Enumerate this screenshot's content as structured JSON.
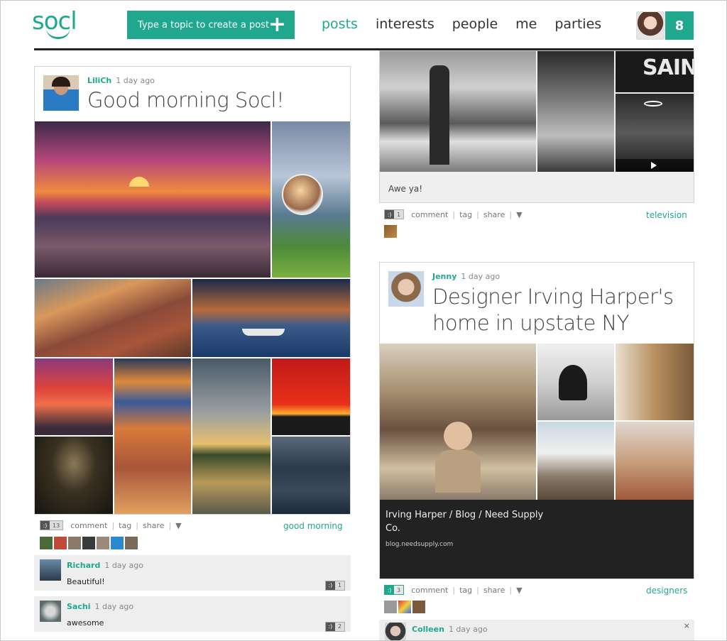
{
  "brand": {
    "logo_text": "socl"
  },
  "header": {
    "create_label": "Type a topic to create a post",
    "create_icon": "plus-icon",
    "nav": [
      "posts",
      "interests",
      "people",
      "me",
      "parties"
    ],
    "notification_count": "8"
  },
  "posts": {
    "lilich": {
      "user": "LiliCh",
      "time": "1 day ago",
      "title": "Good morning Socl!",
      "comment_count": "13",
      "actions": [
        "comment",
        "tag",
        "share"
      ],
      "topic": "good morning",
      "comments": [
        {
          "user": "Richard",
          "time": "1 day ago",
          "text": "Beautiful!",
          "count": "1"
        },
        {
          "user": "Sachi",
          "time": "1 day ago",
          "text": "awesome",
          "count": "2"
        }
      ]
    },
    "tv": {
      "caption": "Awe ya!",
      "comment_count": "1",
      "actions": [
        "comment",
        "tag",
        "share"
      ],
      "topic": "television"
    },
    "jenny": {
      "user": "Jenny",
      "time": "1 day ago",
      "title_line1": "Designer Irving Harper's",
      "title_line2": "home in upstate NY",
      "link_title_line1": "Irving Harper / Blog / Need Supply",
      "link_title_line2": "Co.",
      "link_url": "blog.needsupply.com",
      "comment_count": "3",
      "actions": [
        "comment",
        "tag",
        "share"
      ],
      "topic": "designers",
      "comments": [
        {
          "user": "Colleen",
          "time": "1 day ago"
        }
      ]
    }
  },
  "colors": {
    "accent": "#1fa88e",
    "dark": "#222222"
  }
}
